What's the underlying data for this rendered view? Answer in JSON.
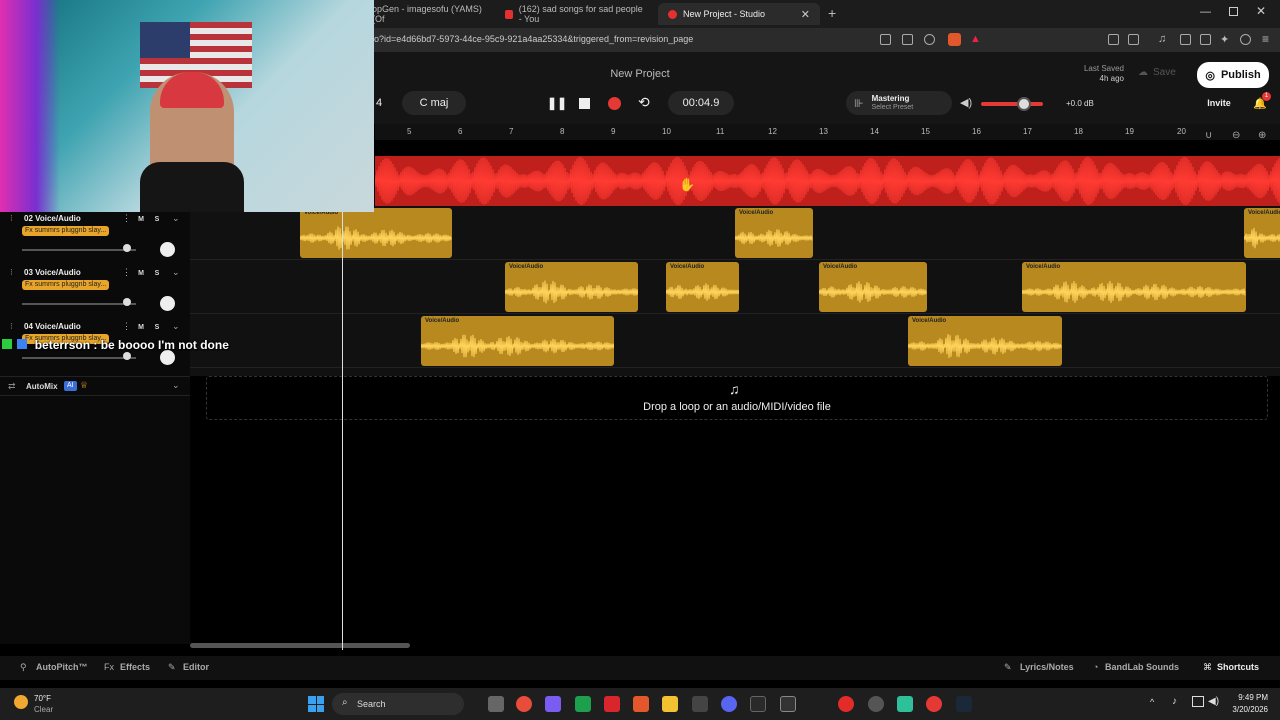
{
  "browser": {
    "tabs": [
      {
        "label": "opGen - imagesofu (YAMS) (Of",
        "fav_color": "#c03535",
        "active": false
      },
      {
        "label": "(162) sad songs for sad people - You",
        "fav_color": "#e53030",
        "active": false
      },
      {
        "label": "New Project - Studio",
        "fav_color": "#e53030",
        "active": true
      }
    ],
    "url": "o?id=e4d66bd7-5973-44ce-95c9-921a4aa25334&triggered_from=revision_page"
  },
  "app": {
    "project_title": "New Project",
    "last_saved_label": "Last Saved",
    "last_saved_time": "4h ago",
    "save_label": "Save",
    "publish_label": "Publish",
    "invite_label": "Invite",
    "notification_count": "1",
    "bar_count": "4",
    "key": "C maj",
    "time": "00:04.9",
    "mastering_label": "Mastering",
    "mastering_sub": "Select Preset",
    "master_volume_db": "+0.0 dB",
    "master_volume_level": 0.7,
    "accent_color": "#e53935",
    "clip_color": "#e9a52a"
  },
  "ruler": {
    "ticks": [
      "5",
      "6",
      "7",
      "8",
      "9",
      "10",
      "11",
      "12",
      "13",
      "14",
      "15",
      "16",
      "17",
      "18",
      "19",
      "20"
    ]
  },
  "tracks": [
    {
      "name": "02 Voice/Audio",
      "fx": "Fx summrs pluggnb slay...",
      "mute": "M",
      "solo": "S",
      "volume": 0.92,
      "clips": [
        {
          "label": "Voice/Audio",
          "start": 0
        },
        {
          "label": "Voice/Audio",
          "start": 1
        },
        {
          "label": "Voice/Audio",
          "start": 2
        }
      ]
    },
    {
      "name": "03 Voice/Audio",
      "fx": "Fx summrs pluggnb slay...",
      "mute": "M",
      "solo": "S",
      "volume": 0.92,
      "clips": [
        {
          "label": "Voice/Audio"
        },
        {
          "label": "Voice/Audio"
        },
        {
          "label": "Voice/Audio"
        },
        {
          "label": "Voice/Audio"
        }
      ]
    },
    {
      "name": "04 Voice/Audio",
      "fx": "Fx summrs pluggnb slay...",
      "mute": "M",
      "solo": "S",
      "volume": 0.92,
      "clips": [
        {
          "label": "Voice/Audio"
        },
        {
          "label": "Voice/Audio"
        }
      ]
    }
  ],
  "automix": {
    "label": "AutoMix",
    "badge": "AI"
  },
  "drop_zone": {
    "text": "Drop a loop or an audio/MIDI/video file"
  },
  "bottom_bar": {
    "autopitch": "AutoPitch™",
    "effects": "Effects",
    "editor": "Editor",
    "lyrics": "Lyrics/Notes",
    "sounds": "BandLab Sounds",
    "shortcuts": "Shortcuts"
  },
  "overlay": {
    "chat_message": "beterrson : be boooo I'm not done"
  },
  "taskbar": {
    "weather_temp": "70°F",
    "weather_desc": "Clear",
    "search_label": "Search",
    "time": "9:49 PM",
    "date": "3/20/2026"
  }
}
